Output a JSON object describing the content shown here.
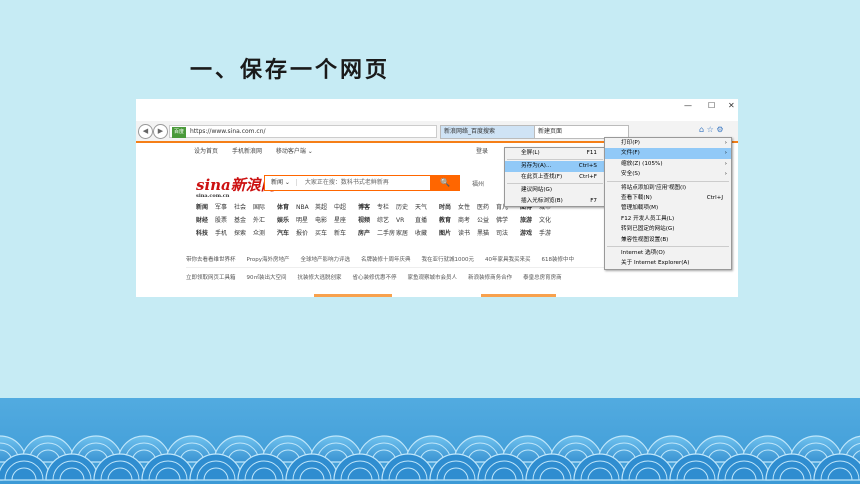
{
  "slide": {
    "title": "一、保存一个网页"
  },
  "browser": {
    "window_controls": [
      "—",
      "☐",
      "✕"
    ],
    "nav": [
      "◀",
      "▶"
    ],
    "address": {
      "badge": "百度",
      "url": "https://www.sina.com.cn/"
    },
    "tabs": [
      {
        "label": "新浪网络_百度搜索"
      },
      {
        "label": "新建页面"
      }
    ]
  },
  "page": {
    "top_nav": [
      "设为首页",
      "手机新浪网",
      "移动客户端 ⌄"
    ],
    "login": "登录",
    "logo": {
      "main": "sina新浪网",
      "sub": "sina.com.cn"
    },
    "search": {
      "scope": "新闻 ⌄",
      "placeholder": "大家正在搜：数科书式老鲜新再",
      "button": "🔍"
    },
    "weather": "福州",
    "link_rows": [
      [
        "新闻",
        "军事",
        "社会",
        "国际",
        "体育",
        "NBA",
        "英超",
        "中超",
        "博客",
        "专栏",
        "历史",
        "天气",
        "时尚",
        "女性",
        "医药",
        "育儿",
        "图博",
        "城市"
      ],
      [
        "财经",
        "股票",
        "基金",
        "外汇",
        "娱乐",
        "明星",
        "电影",
        "星座",
        "视频",
        "综艺",
        "VR",
        "直播",
        "教育",
        "商考",
        "公益",
        "佛学",
        "旅游",
        "文化"
      ],
      [
        "科技",
        "手机",
        "探索",
        "众测",
        "汽车",
        "报价",
        "买车",
        "新车",
        "房产",
        "二手房",
        "家居",
        "收藏",
        "图片",
        "读书",
        "黑猫",
        "司法",
        "游戏",
        "手游"
      ]
    ],
    "news_rows": [
      [
        "带你去看看维世界杯",
        "Propy海外房地产",
        "全球地产影响力评选",
        "名牌装修十周年庆典",
        "我在亚行就城1000元",
        "40年家具我买来买",
        "618装修中中"
      ],
      [
        "立即领取网页工具箱",
        "90㎡装出大空间",
        "抗装修大逃脱创家",
        "省心装修优惠不停",
        "家鱼观察城市会员人",
        "新浪装修商务合作",
        "泰皇总房育房商"
      ]
    ]
  },
  "submenu": {
    "items": [
      {
        "label": "全屏(L)",
        "shortcut": "F11"
      },
      {
        "label": "另存为(A)...",
        "shortcut": "Ctrl+S",
        "highlight": true
      },
      {
        "label": "在此页上查找(F)",
        "shortcut": "Ctrl+F"
      },
      {
        "label": "建议网站(G)",
        "shortcut": ""
      },
      {
        "label": "插入光标浏览(B)",
        "shortcut": "F7"
      }
    ]
  },
  "main_menu": {
    "items": [
      {
        "label": "打印(P)",
        "arrow": "›"
      },
      {
        "label": "文件(F)",
        "arrow": "›",
        "highlight": true
      },
      {
        "label": "缩放(Z) (105%)",
        "arrow": "›"
      },
      {
        "label": "安全(S)",
        "arrow": "›"
      },
      {
        "label": "将站点添加到'应用'视图(I)",
        "arrow": ""
      },
      {
        "label": "查看下载(N)",
        "shortcut": "Ctrl+J"
      },
      {
        "label": "管理加载项(M)",
        "arrow": ""
      },
      {
        "label": "F12 开发人员工具(L)",
        "arrow": ""
      },
      {
        "label": "转到已固定的网站(G)",
        "arrow": ""
      },
      {
        "label": "兼容性视图设置(B)",
        "arrow": ""
      },
      {
        "label": "Internet 选项(O)",
        "arrow": ""
      },
      {
        "label": "关于 Internet Explorer(A)",
        "arrow": ""
      }
    ]
  }
}
